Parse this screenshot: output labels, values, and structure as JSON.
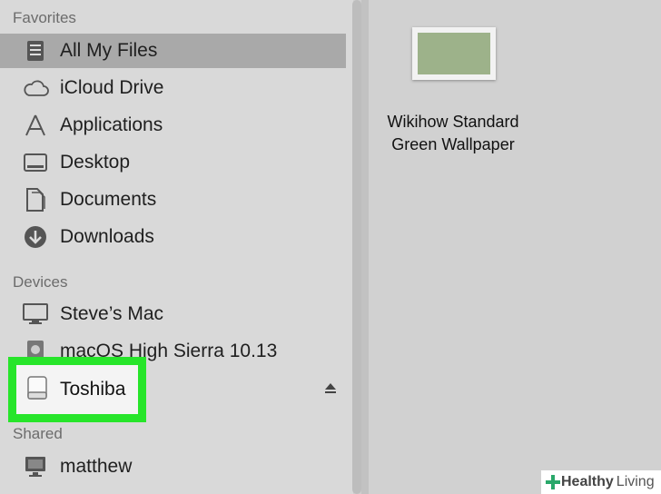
{
  "sidebar": {
    "favorites_header": "Favorites",
    "favorites": [
      {
        "label": "All My Files",
        "icon": "all-files-icon",
        "selected": true
      },
      {
        "label": "iCloud Drive",
        "icon": "cloud-icon"
      },
      {
        "label": "Applications",
        "icon": "applications-icon"
      },
      {
        "label": "Desktop",
        "icon": "desktop-icon"
      },
      {
        "label": "Documents",
        "icon": "documents-icon"
      },
      {
        "label": "Downloads",
        "icon": "downloads-icon"
      }
    ],
    "devices_header": "Devices",
    "devices": [
      {
        "label": "Steve’s Mac",
        "icon": "computer-icon"
      },
      {
        "label": "macOS High Sierra 10.13",
        "icon": "disk-icon"
      },
      {
        "label": "Toshiba",
        "icon": "external-drive-icon",
        "highlighted": true
      }
    ],
    "shared_header": "Shared",
    "shared": [
      {
        "label": "matthew",
        "icon": "monitor-icon"
      }
    ]
  },
  "content": {
    "file": {
      "label_line1": "Wikihow Standard",
      "label_line2": "Green Wallpaper"
    }
  },
  "watermark": {
    "bold": "Healthy",
    "light": "Living"
  },
  "colors": {
    "highlight": "#27e52a",
    "selected_row": "#a9a9a9",
    "wallpaper_green": "#9db28a"
  }
}
